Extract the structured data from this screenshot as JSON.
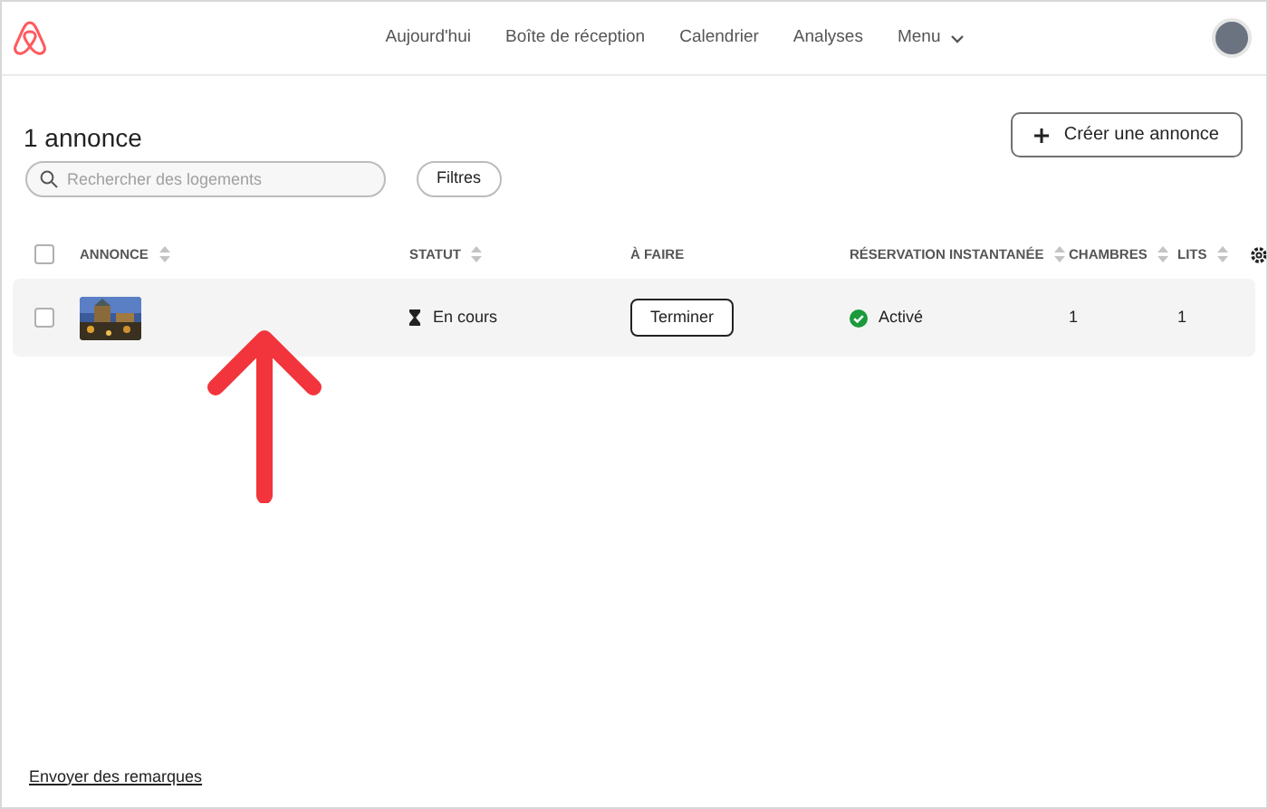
{
  "nav": {
    "items": [
      {
        "label": "Aujourd'hui",
        "dropdown": false
      },
      {
        "label": "Boîte de réception",
        "dropdown": false
      },
      {
        "label": "Calendrier",
        "dropdown": false
      },
      {
        "label": "Analyses",
        "dropdown": false
      },
      {
        "label": "Menu",
        "dropdown": true
      }
    ]
  },
  "title": "1 annonce",
  "create_button": "Créer une annonce",
  "search": {
    "placeholder": "Rechercher des logements"
  },
  "filters_button": "Filtres",
  "table": {
    "select_all_checked": false,
    "columns": [
      {
        "label": "ANNONCE",
        "sortable": true
      },
      {
        "label": "STATUT",
        "sortable": true
      },
      {
        "label": "À FAIRE",
        "sortable": false
      },
      {
        "label": "RÉSERVATION INSTANTANÉE",
        "sortable": true
      },
      {
        "label": "CHAMBRES",
        "sortable": true
      },
      {
        "label": "LITS",
        "sortable": true
      }
    ],
    "rows": [
      {
        "checked": false,
        "status": "En cours",
        "action": "Terminer",
        "instant_booking": "Activé",
        "instant_booking_on": true,
        "bedrooms": "1",
        "beds": "1"
      }
    ]
  },
  "footer_link": "Envoyer des remarques"
}
